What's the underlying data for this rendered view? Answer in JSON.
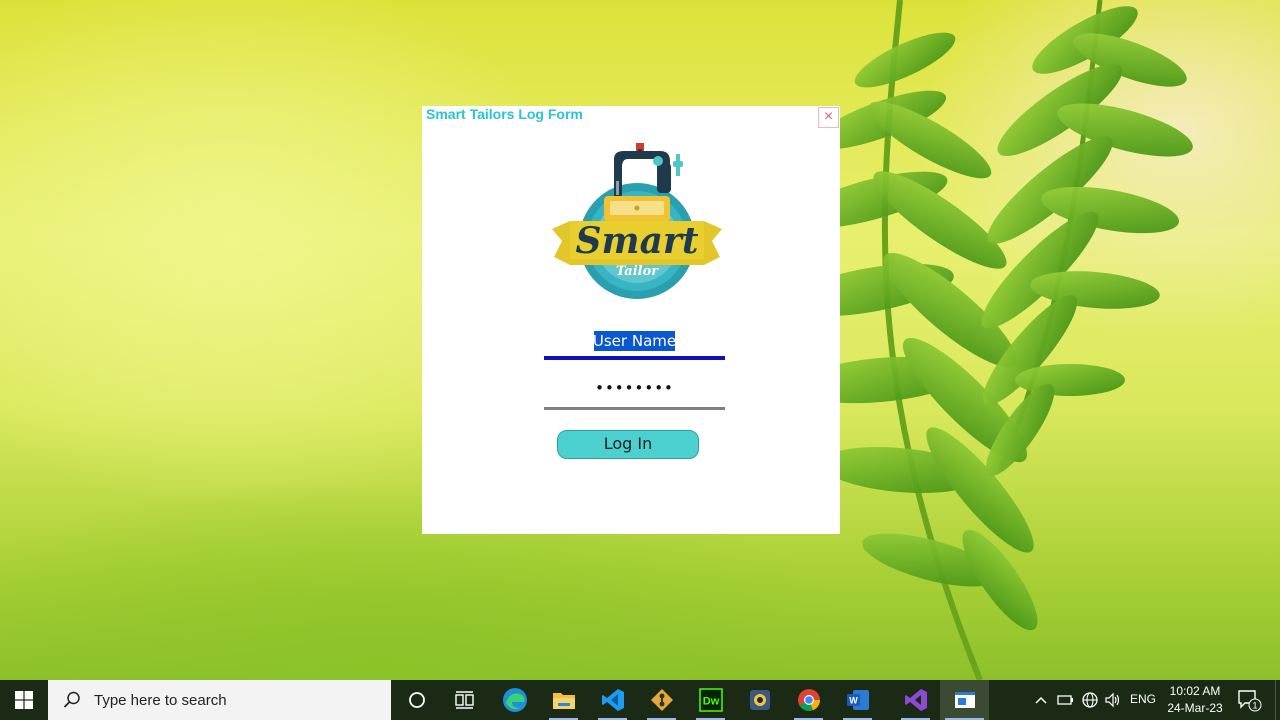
{
  "window": {
    "title": "Smart Tailors Log Form",
    "close_label": "×"
  },
  "logo": {
    "brand": "Smart",
    "subtitle": "Tailor"
  },
  "form": {
    "username_value": "User Name",
    "password_value": "••••••••",
    "login_label": "Log In"
  },
  "taskbar": {
    "search_placeholder": "Type here to search",
    "apps": [
      "cortana-icon",
      "task-view-icon",
      "edge-icon",
      "file-explorer-icon",
      "vscode-icon",
      "git-icon",
      "dreamweaver-icon",
      "app-icon",
      "chrome-icon",
      "word-icon",
      "visual-studio-icon",
      "window-app-icon"
    ],
    "language": "ENG",
    "time": "10:02 AM",
    "date": "24-Mar-23",
    "notification_count": "1"
  },
  "colors": {
    "title": "#29c4d6",
    "close": "#e45f75",
    "username_underline": "#1010b8",
    "password_underline": "#808080",
    "button_bg": "#4cd0d0",
    "selection": "#0a58cf"
  }
}
